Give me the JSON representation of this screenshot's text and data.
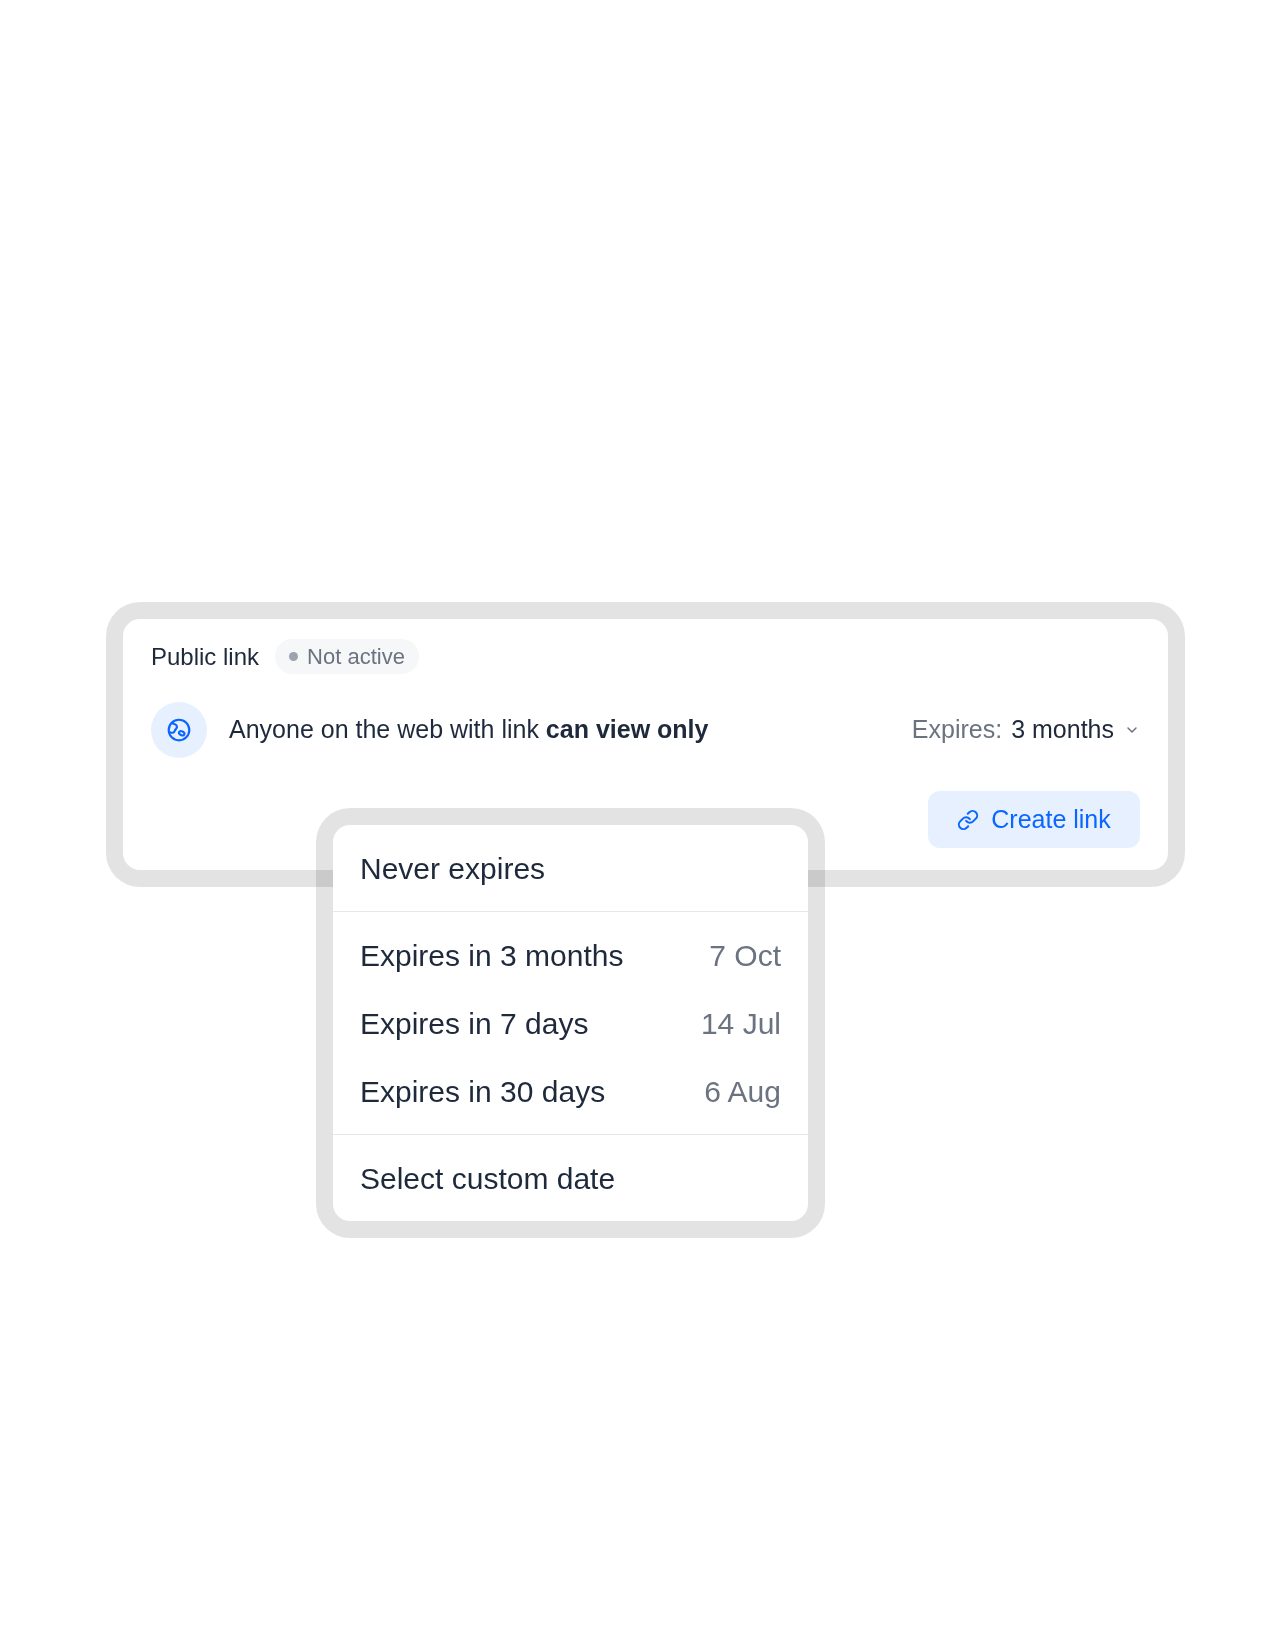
{
  "card": {
    "title": "Public link",
    "status": {
      "label": "Not active",
      "active": false
    },
    "permission": {
      "text": "Anyone on the web with link **can view only**"
    },
    "expiry": {
      "label": "Expires:",
      "value": "3 months",
      "expanded": true
    },
    "create_button": {
      "label": "Create link"
    }
  },
  "menu": {
    "groups": [
      {
        "items": [
          {
            "label": "Never expires"
          }
        ]
      },
      {
        "items": [
          {
            "label": "Expires in 3 months",
            "date": "7 Oct"
          },
          {
            "label": "Expires in 7 days",
            "date": "14 Jul"
          },
          {
            "label": "Expires in 30 days",
            "date": "6 Aug"
          }
        ]
      },
      {
        "items": [
          {
            "label": "Select custom date"
          }
        ]
      }
    ]
  }
}
